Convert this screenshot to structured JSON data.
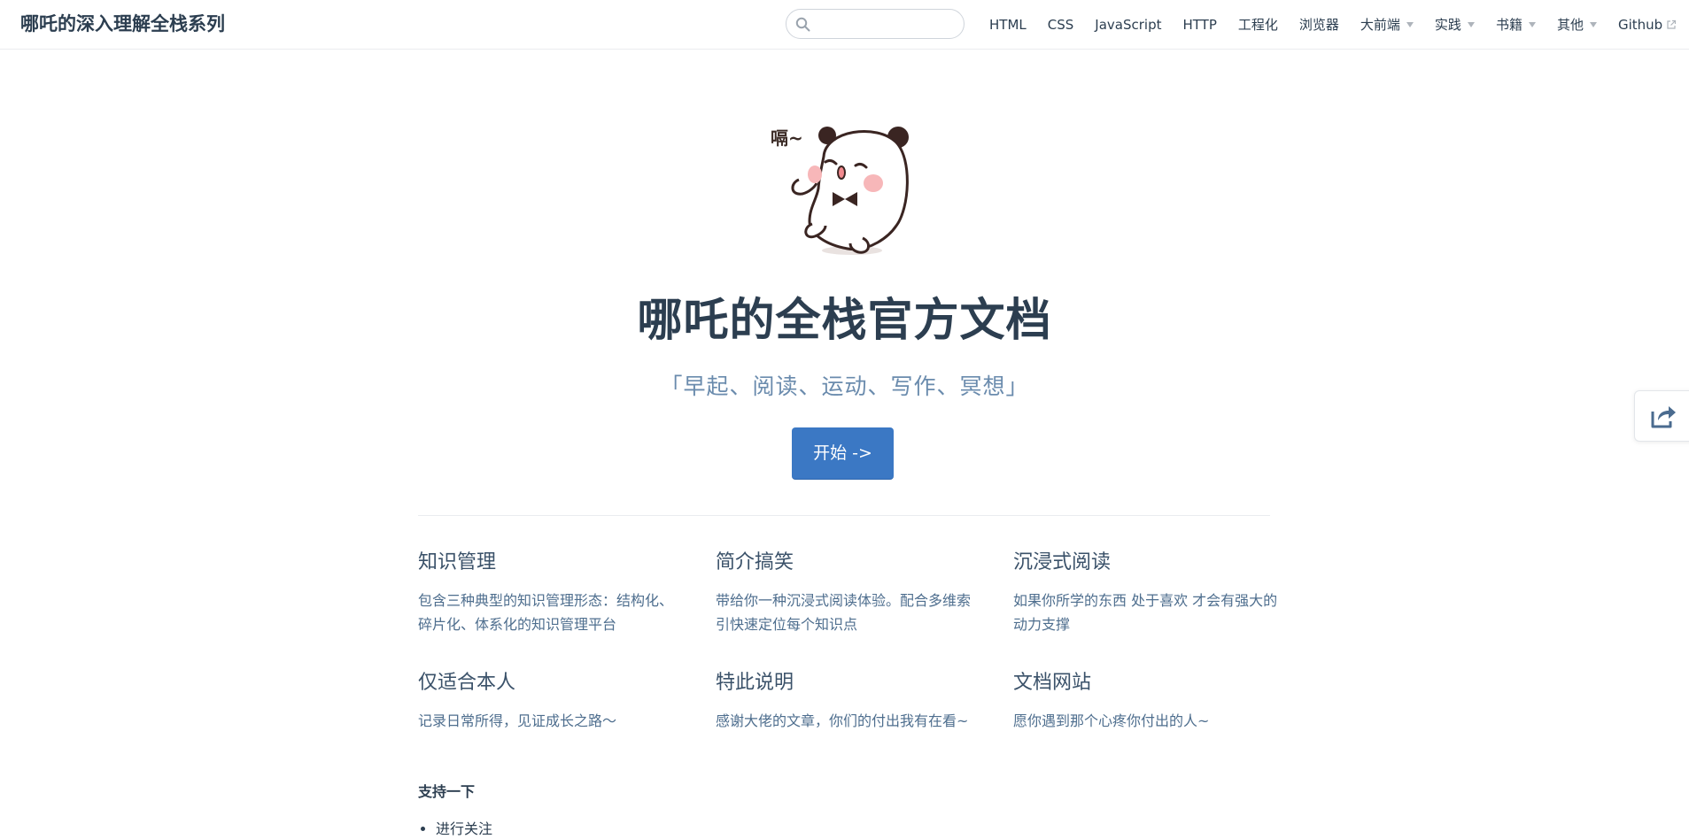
{
  "navbar": {
    "site_name": "哪吒的深入理解全栈系列",
    "search": {
      "value": "",
      "placeholder": ""
    },
    "items": [
      {
        "label": "HTML",
        "dropdown": false,
        "external": false
      },
      {
        "label": "CSS",
        "dropdown": false,
        "external": false
      },
      {
        "label": "JavaScript",
        "dropdown": false,
        "external": false
      },
      {
        "label": "HTTP",
        "dropdown": false,
        "external": false
      },
      {
        "label": "工程化",
        "dropdown": false,
        "external": false
      },
      {
        "label": "浏览器",
        "dropdown": false,
        "external": false
      },
      {
        "label": "大前端",
        "dropdown": true,
        "external": false
      },
      {
        "label": "实践",
        "dropdown": true,
        "external": false
      },
      {
        "label": "书籍",
        "dropdown": true,
        "external": false
      },
      {
        "label": "其他",
        "dropdown": true,
        "external": false
      },
      {
        "label": "Github",
        "dropdown": false,
        "external": true
      }
    ]
  },
  "hero": {
    "image_icon": "panda-mascot-icon",
    "image_text": "嗝~",
    "title": "哪吒的全栈官方文档",
    "description": "「早起、阅读、运动、写作、冥想」",
    "action_label": "开始 ->"
  },
  "features": [
    {
      "title": "知识管理",
      "details": "包含三种典型的知识管理形态：结构化、碎片化、体系化的知识管理平台"
    },
    {
      "title": "简介搞笑",
      "details": "带给你一种沉浸式阅读体验。配合多维索引快速定位每个知识点"
    },
    {
      "title": "沉浸式阅读",
      "details": "如果你所学的东西 处于喜欢 才会有强大的动力支撑"
    },
    {
      "title": "仅适合本人",
      "details": "记录日常所得，见证成长之路～"
    },
    {
      "title": "特此说明",
      "details": "感谢大佬的文章，你们的付出我有在看~"
    },
    {
      "title": "文档网站",
      "details": "愿你遇到那个心疼你付出的人~"
    }
  ],
  "support": {
    "title": "支持一下",
    "items": [
      "进行关注"
    ]
  },
  "share": {
    "icon": "share-icon"
  },
  "colors": {
    "accent": "#3b78c4",
    "text": "#2c3e50",
    "muted": "#6a8bad"
  }
}
